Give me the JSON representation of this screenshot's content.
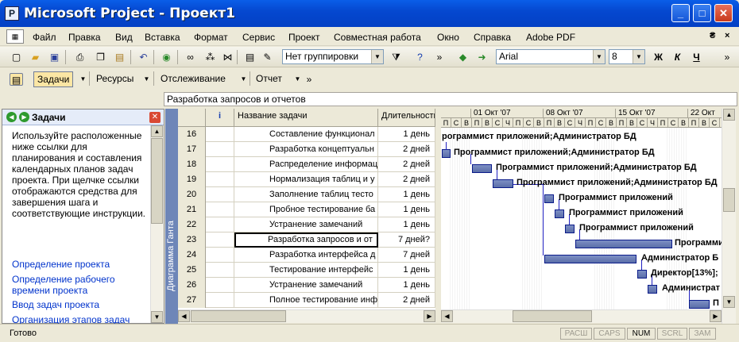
{
  "window": {
    "title": "Microsoft Project - Проект1",
    "minimize": "_",
    "maximize": "□",
    "close": "✕"
  },
  "menu": {
    "items": [
      "Файл",
      "Правка",
      "Вид",
      "Вставка",
      "Формат",
      "Сервис",
      "Проект",
      "Совместная работа",
      "Окно",
      "Справка",
      "Adobe PDF"
    ],
    "restore": "₴",
    "close": "×"
  },
  "toolbar": {
    "grouping": "Нет группировки",
    "font": "Arial",
    "font_size": "8",
    "bold": "Ж",
    "italic": "К",
    "underline": "Ч"
  },
  "guide_toolbar": {
    "tasks": "Задачи",
    "resources": "Ресурсы",
    "tracking": "Отслеживание",
    "report": "Отчет"
  },
  "entry_bar": {
    "value": "Разработка запросов и отчетов"
  },
  "side_pane": {
    "title": "Задачи",
    "description": "Используйте расположенные ниже ссылки для планирования и составления календарных планов задач проекта. При щелчке ссылки отображаются средства для завершения шага и соответствующие инструкции.",
    "links": [
      "Определение проекта",
      "Определение рабочего времени проекта",
      "Ввод задач проекта",
      "Организация этапов задач"
    ]
  },
  "view_label": "Диаграмма Ганта",
  "table": {
    "columns": {
      "id": "",
      "indicators": "i",
      "name": "Название задачи",
      "duration": "Длительность"
    },
    "rows": [
      {
        "id": "16",
        "name": "Составление функционал",
        "duration": "1 день"
      },
      {
        "id": "17",
        "name": "Разработка концептуальн",
        "duration": "2 дней"
      },
      {
        "id": "18",
        "name": "Распределение информац",
        "duration": "2 дней"
      },
      {
        "id": "19",
        "name": "Нормализация таблиц и у",
        "duration": "2 дней"
      },
      {
        "id": "20",
        "name": "Заполнение таблиц тесто",
        "duration": "1 день"
      },
      {
        "id": "21",
        "name": "Пробное тестирование ба",
        "duration": "1 день"
      },
      {
        "id": "22",
        "name": "Устранение замечаний",
        "duration": "1 день"
      },
      {
        "id": "23",
        "name": "Разработка запросов и от",
        "duration": "7 дней?"
      },
      {
        "id": "24",
        "name": "Разработка интерфейса д",
        "duration": "7 дней"
      },
      {
        "id": "25",
        "name": "Тестирование интерфейс",
        "duration": "1 день"
      },
      {
        "id": "26",
        "name": "Устранение замечаний",
        "duration": "1 день"
      },
      {
        "id": "27",
        "name": "Полное тестирование инф",
        "duration": "2 дней"
      }
    ]
  },
  "gantt": {
    "weeks": [
      "01 Окт '07",
      "08 Окт '07",
      "15 Окт '07",
      "22 Окт"
    ],
    "days": [
      "П",
      "С",
      "В",
      "П",
      "В",
      "С",
      "Ч",
      "П",
      "С",
      "В",
      "П",
      "В",
      "С",
      "Ч",
      "П",
      "С",
      "В",
      "П",
      "В",
      "С",
      "Ч",
      "П",
      "С",
      "В",
      "П",
      "В",
      "С"
    ],
    "labels": [
      "рограммист приложений;Администратор БД",
      "Программист приложений;Администратор БД",
      "Программист приложений;Администратор БД",
      "Программист приложений;Администратор БД",
      "Программист приложений",
      "Программист приложений",
      "Программист приложений",
      "Программи",
      "Администратор Б",
      "Директор[13%];",
      "Администрат",
      "П"
    ]
  },
  "status": {
    "text": "Готово",
    "indicators": [
      "РАСШ",
      "CAPS",
      "NUM",
      "SCRL",
      "ЗАМ"
    ]
  }
}
